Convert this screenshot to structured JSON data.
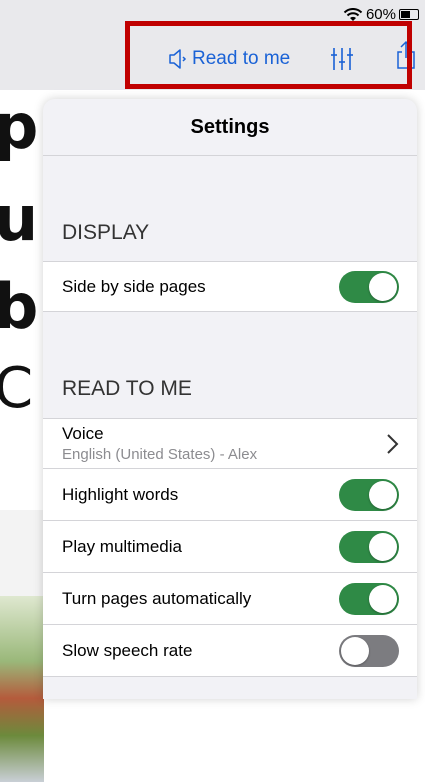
{
  "status": {
    "battery_text": "60%",
    "battery_level": 0.6
  },
  "toolbar": {
    "read_to_me_label": "Read to me",
    "icons": [
      "speaker-icon",
      "sliders-icon",
      "share-icon"
    ],
    "accent_color": "#1a62d6",
    "highlight_color": "#c00000"
  },
  "settings": {
    "title": "Settings",
    "display_section": {
      "label": "DISPLAY",
      "items": [
        {
          "label": "Side by side pages",
          "toggle": true
        }
      ]
    },
    "read_section": {
      "label": "READ TO ME",
      "voice": {
        "label": "Voice",
        "value": "English (United States) - Alex"
      },
      "items": [
        {
          "label": "Highlight words",
          "toggle": true
        },
        {
          "label": "Play multimedia",
          "toggle": true
        },
        {
          "label": "Turn pages automatically",
          "toggle": true
        },
        {
          "label": "Slow speech rate",
          "toggle": false
        }
      ]
    },
    "toggle_on_color": "#2f8a46",
    "toggle_off_color": "#7c7c80"
  },
  "background_letters": [
    "p",
    "u",
    "b",
    "C"
  ]
}
